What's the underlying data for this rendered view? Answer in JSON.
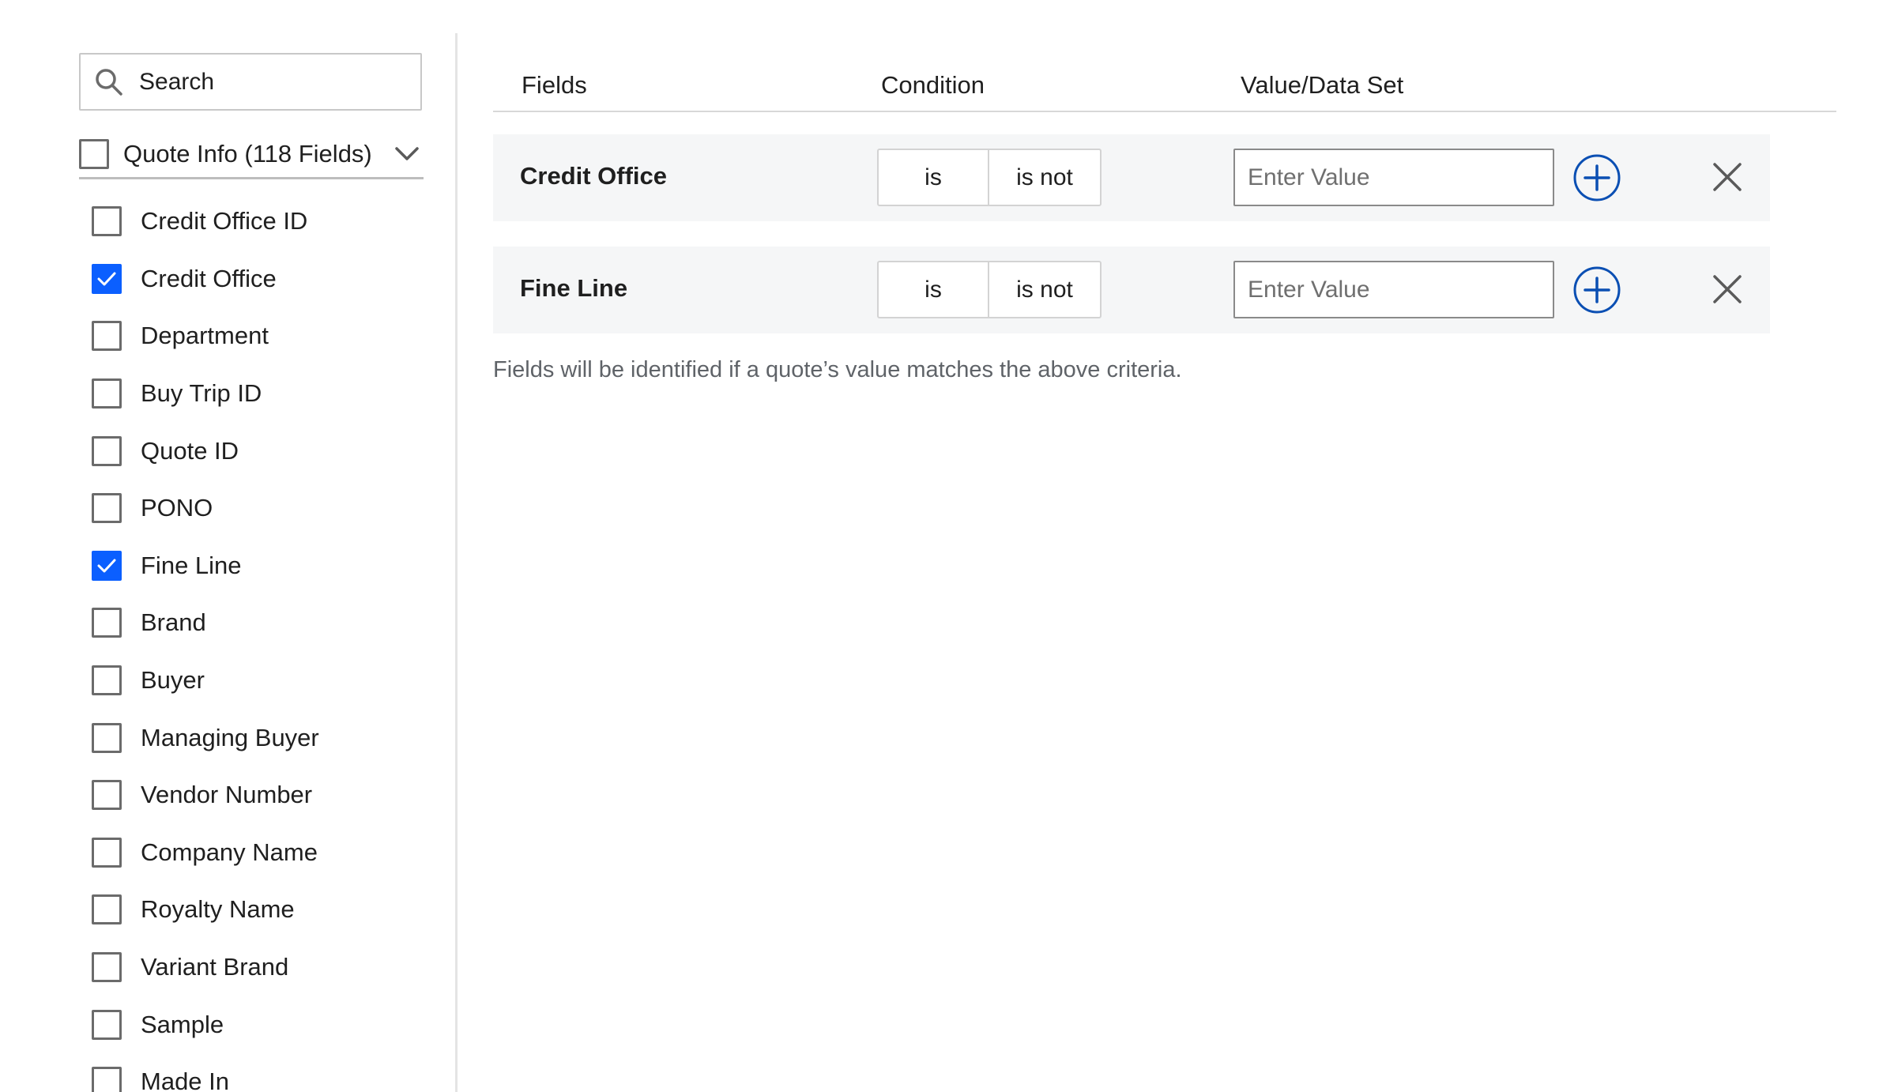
{
  "search": {
    "placeholder": "Search"
  },
  "group": {
    "label": "Quote Info (118 Fields)",
    "checked": false
  },
  "fields": [
    {
      "label": "Credit Office ID",
      "checked": false
    },
    {
      "label": "Credit Office",
      "checked": true
    },
    {
      "label": "Department",
      "checked": false
    },
    {
      "label": "Buy Trip ID",
      "checked": false
    },
    {
      "label": "Quote ID",
      "checked": false
    },
    {
      "label": "PONO",
      "checked": false
    },
    {
      "label": "Fine Line",
      "checked": true
    },
    {
      "label": "Brand",
      "checked": false
    },
    {
      "label": "Buyer",
      "checked": false
    },
    {
      "label": "Managing Buyer",
      "checked": false
    },
    {
      "label": "Vendor Number",
      "checked": false
    },
    {
      "label": "Company Name",
      "checked": false
    },
    {
      "label": "Royalty Name",
      "checked": false
    },
    {
      "label": "Variant Brand",
      "checked": false
    },
    {
      "label": "Sample",
      "checked": false
    },
    {
      "label": "Made In",
      "checked": false
    }
  ],
  "columns": {
    "fields": "Fields",
    "condition": "Condition",
    "value": "Value/Data Set"
  },
  "criteria": [
    {
      "field": "Credit Office",
      "condition_is": "is",
      "condition_is_not": "is not",
      "value_placeholder": "Enter Value"
    },
    {
      "field": "Fine Line",
      "condition_is": "is",
      "condition_is_not": "is not",
      "value_placeholder": "Enter Value"
    }
  ],
  "helper_text": "Fields will be identified if a quote’s value matches the above criteria.",
  "colors": {
    "accent": "#0b5fff",
    "add_icon": "#0b4fb3",
    "row_bg": "#f5f6f7"
  },
  "icons": {
    "search": "search-icon",
    "chevron": "chevron-down-icon",
    "add": "plus-circle-icon",
    "remove": "close-icon",
    "check": "check-icon"
  }
}
